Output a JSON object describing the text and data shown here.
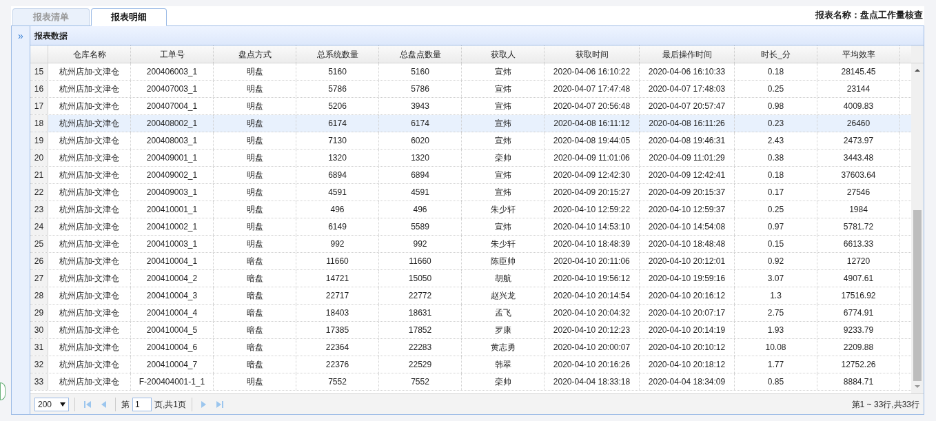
{
  "tabs": [
    {
      "label": "报表清单",
      "selected": false
    },
    {
      "label": "报表明细",
      "selected": true
    }
  ],
  "report_name": "报表名称：盘点工作量核查",
  "panel": {
    "collapse_glyph": "»",
    "title": "报表数据"
  },
  "table": {
    "columns": [
      "仓库名称",
      "工单号",
      "盘点方式",
      "总系统数量",
      "总盘点数量",
      "获取人",
      "获取时间",
      "最后操作时间",
      "时长_分",
      "平均效率"
    ],
    "rows": [
      {
        "number": "15",
        "selected": false,
        "cells": [
          "杭州店加-文津仓",
          "200406003_1",
          "明盘",
          "5160",
          "5160",
          "宣炜",
          "2020-04-06 16:10:22",
          "2020-04-06 16:10:33",
          "0.18",
          "28145.45"
        ]
      },
      {
        "number": "16",
        "selected": false,
        "cells": [
          "杭州店加-文津仓",
          "200407003_1",
          "明盘",
          "5786",
          "5786",
          "宣炜",
          "2020-04-07 17:47:48",
          "2020-04-07 17:48:03",
          "0.25",
          "23144"
        ]
      },
      {
        "number": "17",
        "selected": false,
        "cells": [
          "杭州店加-文津仓",
          "200407004_1",
          "明盘",
          "5206",
          "3943",
          "宣炜",
          "2020-04-07 20:56:48",
          "2020-04-07 20:57:47",
          "0.98",
          "4009.83"
        ]
      },
      {
        "number": "18",
        "selected": true,
        "cells": [
          "杭州店加-文津仓",
          "200408002_1",
          "明盘",
          "6174",
          "6174",
          "宣炜",
          "2020-04-08 16:11:12",
          "2020-04-08 16:11:26",
          "0.23",
          "26460"
        ]
      },
      {
        "number": "19",
        "selected": false,
        "cells": [
          "杭州店加-文津仓",
          "200408003_1",
          "明盘",
          "7130",
          "6020",
          "宣炜",
          "2020-04-08 19:44:05",
          "2020-04-08 19:46:31",
          "2.43",
          "2473.97"
        ]
      },
      {
        "number": "20",
        "selected": false,
        "cells": [
          "杭州店加-文津仓",
          "200409001_1",
          "明盘",
          "1320",
          "1320",
          "栾帅",
          "2020-04-09 11:01:06",
          "2020-04-09 11:01:29",
          "0.38",
          "3443.48"
        ]
      },
      {
        "number": "21",
        "selected": false,
        "cells": [
          "杭州店加-文津仓",
          "200409002_1",
          "明盘",
          "6894",
          "6894",
          "宣炜",
          "2020-04-09 12:42:30",
          "2020-04-09 12:42:41",
          "0.18",
          "37603.64"
        ]
      },
      {
        "number": "22",
        "selected": false,
        "cells": [
          "杭州店加-文津仓",
          "200409003_1",
          "明盘",
          "4591",
          "4591",
          "宣炜",
          "2020-04-09 20:15:27",
          "2020-04-09 20:15:37",
          "0.17",
          "27546"
        ]
      },
      {
        "number": "23",
        "selected": false,
        "cells": [
          "杭州店加-文津仓",
          "200410001_1",
          "明盘",
          "496",
          "496",
          "朱少轩",
          "2020-04-10 12:59:22",
          "2020-04-10 12:59:37",
          "0.25",
          "1984"
        ]
      },
      {
        "number": "24",
        "selected": false,
        "cells": [
          "杭州店加-文津仓",
          "200410002_1",
          "明盘",
          "6149",
          "5589",
          "宣炜",
          "2020-04-10 14:53:10",
          "2020-04-10 14:54:08",
          "0.97",
          "5781.72"
        ]
      },
      {
        "number": "25",
        "selected": false,
        "cells": [
          "杭州店加-文津仓",
          "200410003_1",
          "明盘",
          "992",
          "992",
          "朱少轩",
          "2020-04-10 18:48:39",
          "2020-04-10 18:48:48",
          "0.15",
          "6613.33"
        ]
      },
      {
        "number": "26",
        "selected": false,
        "cells": [
          "杭州店加-文津仓",
          "200410004_1",
          "暗盘",
          "11660",
          "11660",
          "陈臣帅",
          "2020-04-10 20:11:06",
          "2020-04-10 20:12:01",
          "0.92",
          "12720"
        ]
      },
      {
        "number": "27",
        "selected": false,
        "cells": [
          "杭州店加-文津仓",
          "200410004_2",
          "暗盘",
          "14721",
          "15050",
          "胡航",
          "2020-04-10 19:56:12",
          "2020-04-10 19:59:16",
          "3.07",
          "4907.61"
        ]
      },
      {
        "number": "28",
        "selected": false,
        "cells": [
          "杭州店加-文津仓",
          "200410004_3",
          "暗盘",
          "22717",
          "22772",
          "赵兴龙",
          "2020-04-10 20:14:54",
          "2020-04-10 20:16:12",
          "1.3",
          "17516.92"
        ]
      },
      {
        "number": "29",
        "selected": false,
        "cells": [
          "杭州店加-文津仓",
          "200410004_4",
          "暗盘",
          "18403",
          "18631",
          "孟飞",
          "2020-04-10 20:04:32",
          "2020-04-10 20:07:17",
          "2.75",
          "6774.91"
        ]
      },
      {
        "number": "30",
        "selected": false,
        "cells": [
          "杭州店加-文津仓",
          "200410004_5",
          "暗盘",
          "17385",
          "17852",
          "罗康",
          "2020-04-10 20:12:23",
          "2020-04-10 20:14:19",
          "1.93",
          "9233.79"
        ]
      },
      {
        "number": "31",
        "selected": false,
        "cells": [
          "杭州店加-文津仓",
          "200410004_6",
          "暗盘",
          "22364",
          "22283",
          "黄志勇",
          "2020-04-10 20:00:07",
          "2020-04-10 20:10:12",
          "10.08",
          "2209.88"
        ]
      },
      {
        "number": "32",
        "selected": false,
        "cells": [
          "杭州店加-文津仓",
          "200410004_7",
          "暗盘",
          "22376",
          "22529",
          "韩翠",
          "2020-04-10 20:16:26",
          "2020-04-10 20:18:12",
          "1.77",
          "12752.26"
        ]
      },
      {
        "number": "33",
        "selected": false,
        "cells": [
          "杭州店加-文津仓",
          "F-200404001-1_1",
          "明盘",
          "7552",
          "7552",
          "栾帅",
          "2020-04-04 18:33:18",
          "2020-04-04 18:34:09",
          "0.85",
          "8884.71"
        ]
      }
    ]
  },
  "pager": {
    "page_size": "200",
    "page_label_before": "第",
    "page_value": "1",
    "page_label_after": "页,共1页",
    "summary": "第1 ~ 33行,共33行"
  }
}
